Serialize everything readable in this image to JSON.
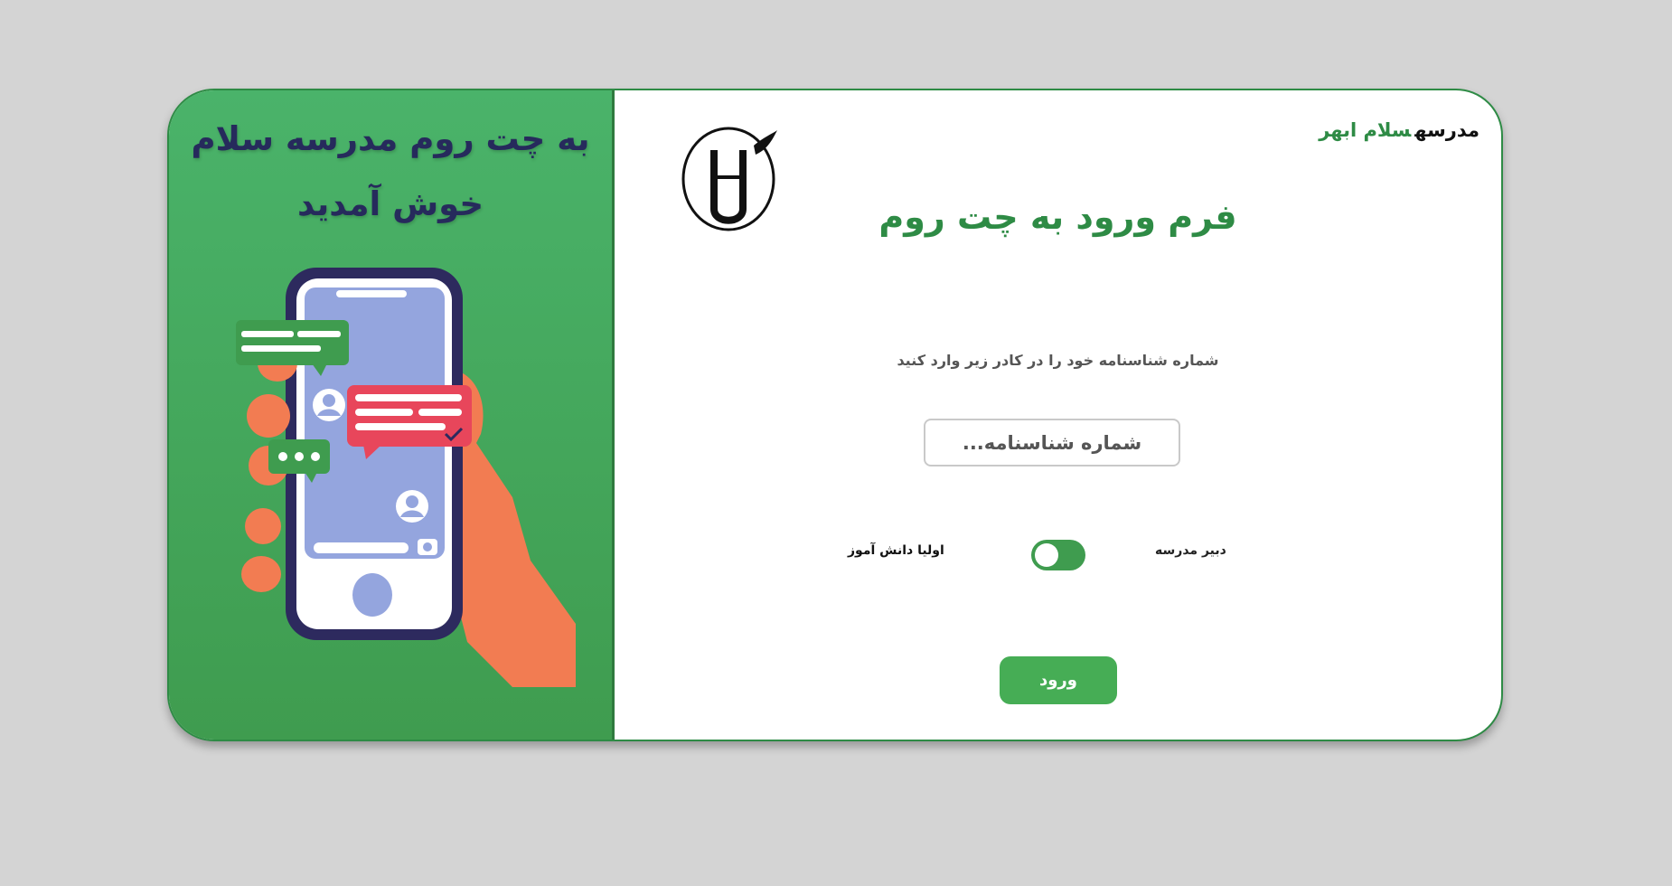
{
  "welcome": {
    "line1": "به چت روم مدرسه سلام",
    "line2": "خوش آمدید"
  },
  "brand": {
    "part1": "مدرسه",
    "part2": "سلام ابهر"
  },
  "form": {
    "title": "فرم ورود به چت روم",
    "hint": "شماره شناسنامه خود را در کادر زیر وارد کنید",
    "id_placeholder": "شماره شناسنامه...",
    "id_value": "",
    "role_left": "اولیا دانش آموز",
    "role_right": "دبیر مدرسه",
    "toggle_state": "left",
    "login_label": "ورود"
  },
  "colors": {
    "accent_green": "#2e8b45",
    "panel_green": "#4ab36a",
    "button_green": "#46ad55",
    "welcome_text": "#262a5c",
    "background": "#d4d4d4"
  },
  "icons": {
    "logo": "school-logo-icon",
    "illustration": "phone-chat-illustration"
  }
}
